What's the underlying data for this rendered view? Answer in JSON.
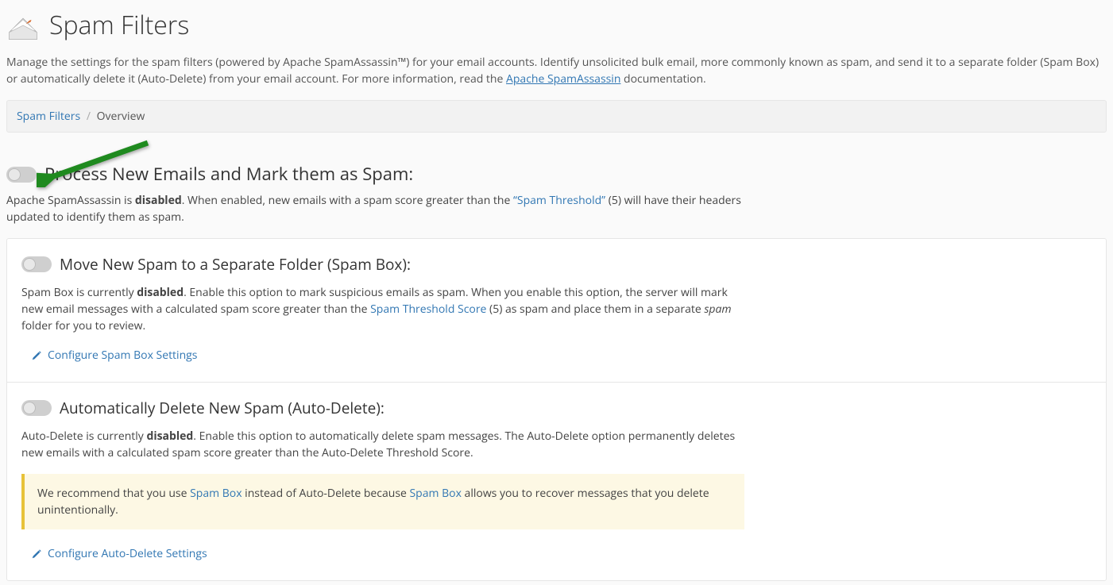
{
  "header": {
    "title": "Spam Filters"
  },
  "description": {
    "pre": "Manage the settings for the spam filters (powered by Apache SpamAssassin™) for your email accounts. Identify unsolicited bulk email, more commonly known as spam, and send it to a separate folder (Spam Box) or automatically delete it (Auto-Delete) from your email account. For more information, read the ",
    "link": "Apache SpamAssassin",
    "post": " documentation."
  },
  "breadcrumb": {
    "root": "Spam Filters",
    "current": "Overview"
  },
  "process": {
    "heading": "Process New Emails and Mark them as Spam:",
    "p1": "Apache SpamAssassin is ",
    "disabled": "disabled",
    "p2": ". When enabled, new emails with a spam score greater than the ",
    "link": "“Spam Threshold”",
    "p3": " (5) will have their headers updated to identify them as spam."
  },
  "spambox": {
    "heading": "Move New Spam to a Separate Folder (Spam Box):",
    "p1": "Spam Box is currently ",
    "disabled": "disabled",
    "p2": ". Enable this option to mark suspicious emails as spam. When you enable this option, the server will mark new email messages with a calculated spam score greater than the ",
    "link": "Spam Threshold Score",
    "p3": " (5) as spam and place them in a separate ",
    "spamword": "spam",
    "p4": " folder for you to review.",
    "action": "Configure Spam Box Settings"
  },
  "autodelete": {
    "heading": "Automatically Delete New Spam (Auto-Delete):",
    "p1": "Auto-Delete is currently ",
    "disabled": "disabled",
    "p2": ". Enable this option to automatically delete spam messages. The Auto-Delete option permanently deletes new emails with a calculated spam score greater than the Auto-Delete Threshold Score.",
    "callout_pre": "We recommend that you use ",
    "callout_link1": "Spam Box",
    "callout_mid": " instead of Auto-Delete because ",
    "callout_link2": "Spam Box",
    "callout_post": " allows you to recover messages that you delete unintentionally.",
    "action": "Configure Auto-Delete Settings"
  }
}
